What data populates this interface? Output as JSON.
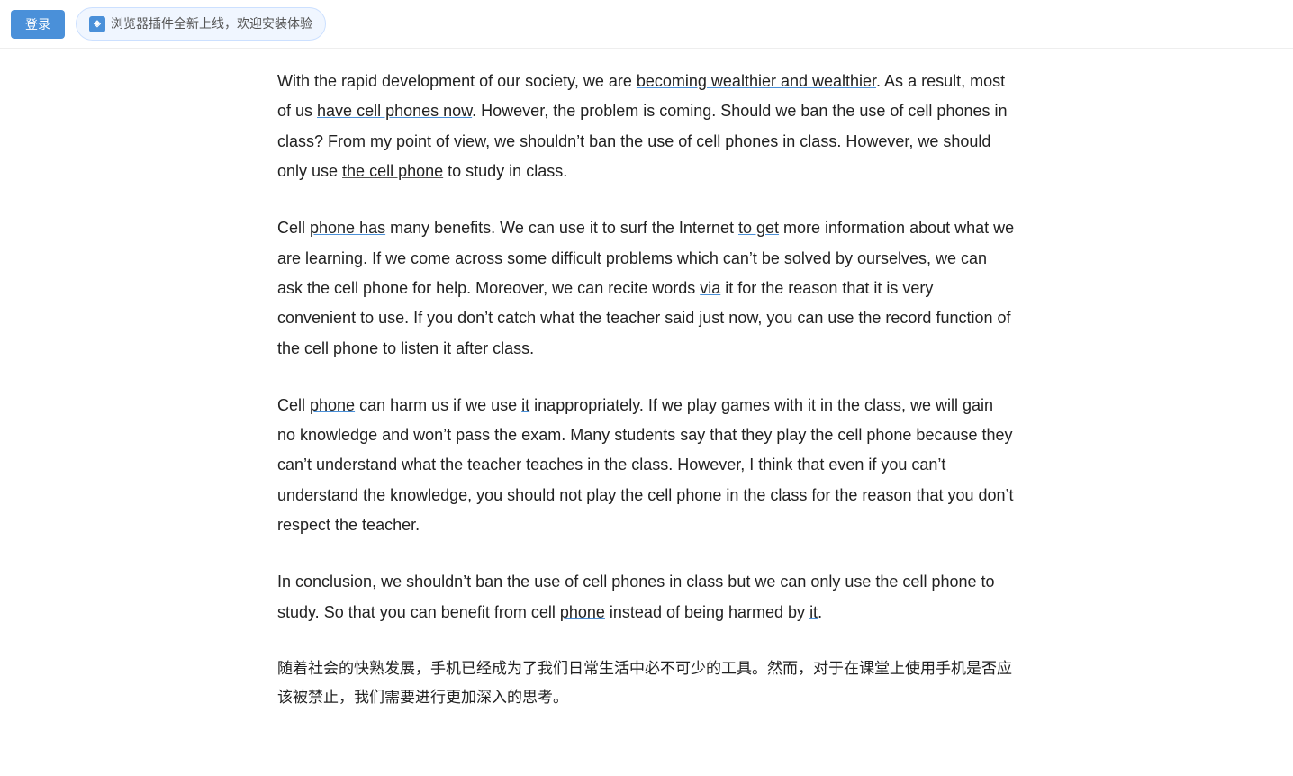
{
  "topbar": {
    "login_label": "登录",
    "plugin_icon_text": "◈",
    "plugin_banner_text": "浏览器插件全新上线，欢迎安装体验"
  },
  "paragraphs": [
    {
      "id": "p1",
      "segments": [
        {
          "text": "With the rapid development of our society, we are ",
          "style": "normal"
        },
        {
          "text": "becoming wealthier and wealthier",
          "style": "underline-blue"
        },
        {
          "text": ". As a result, most of us ",
          "style": "normal"
        },
        {
          "text": "have cell phones now",
          "style": "underline-blue"
        },
        {
          "text": ". However, the problem is coming. Should we ban the use of cell phones in class? From my point of view, we shouldn’t ban the use of cell phones in class. However, we should only use ",
          "style": "normal"
        },
        {
          "text": "the cell phone",
          "style": "underline-dark"
        },
        {
          "text": " to study in class.",
          "style": "normal"
        }
      ]
    },
    {
      "id": "p2",
      "segments": [
        {
          "text": "Cell ",
          "style": "normal"
        },
        {
          "text": "phone has",
          "style": "underline-blue"
        },
        {
          "text": " many benefits. We can use it to surf the Internet ",
          "style": "normal"
        },
        {
          "text": "to get",
          "style": "underline-blue"
        },
        {
          "text": " more information about what we are learning. If we come across some difficult problems which can’t be solved by ourselves, we can ask the cell phone for help. Moreover, we can recite words ",
          "style": "normal"
        },
        {
          "text": "via",
          "style": "underline-blue"
        },
        {
          "text": " it for the reason that it is very convenient to use. If you don’t catch what the teacher said just now, you can use the record function of the cell phone to listen it after class.",
          "style": "normal"
        }
      ]
    },
    {
      "id": "p3",
      "segments": [
        {
          "text": "Cell ",
          "style": "normal"
        },
        {
          "text": "phone",
          "style": "underline-blue"
        },
        {
          "text": " can harm us if we use ",
          "style": "normal"
        },
        {
          "text": "it",
          "style": "underline-blue"
        },
        {
          "text": " inappropriately. If we play games with it in the class, we will gain no knowledge and won’t pass the exam. Many students say that they play the cell phone because they can’t understand what the teacher teaches in the class. However, I think that even if you can’t understand the knowledge, you should not play the cell phone in the class for the reason that you don’t respect the teacher.",
          "style": "normal"
        }
      ]
    },
    {
      "id": "p4",
      "segments": [
        {
          "text": "In conclusion, we shouldn’t ban the use of cell phones in class but we can only use the cell phone to study. So that you can benefit from cell ",
          "style": "normal"
        },
        {
          "text": "phone",
          "style": "underline-blue"
        },
        {
          "text": " instead of being harmed by ",
          "style": "normal"
        },
        {
          "text": "it",
          "style": "underline-blue"
        },
        {
          "text": ".",
          "style": "normal"
        }
      ]
    },
    {
      "id": "p5",
      "segments": [
        {
          "text": "随着社会的快熟发展，手机已经成为了我们日常生活中必不可少的工具。然而，对于在课堂上使用手机是否应该被禁止，我们需要进行更加深入的思考。",
          "style": "chinese"
        }
      ]
    }
  ]
}
